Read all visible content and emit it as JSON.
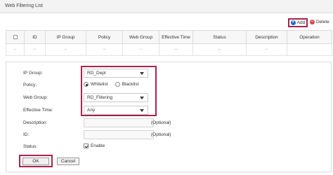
{
  "title": "Web Filtering List",
  "toolbar": {
    "add_label": "Add",
    "add_icon": "plus-circle-icon",
    "delete_label": "Delete",
    "delete_icon": "minus-circle-icon",
    "accent": "#a8234f"
  },
  "table": {
    "columns": [
      "ID",
      "IP Group",
      "Policy",
      "Web Group",
      "Effective Time",
      "Status",
      "Description",
      "Operation"
    ],
    "empty_row": [
      "--",
      "--",
      "--",
      "--",
      "--",
      "--",
      "--",
      "--"
    ]
  },
  "form": {
    "ip_group": {
      "label": "IP Group:",
      "value": "RD_Dept"
    },
    "policy": {
      "label": "Policy:",
      "options": [
        "Whitelist",
        "Blacklist"
      ],
      "selected": "Whitelist"
    },
    "web_group": {
      "label": "Web Group:",
      "value": "RD_Filtering"
    },
    "effective_time": {
      "label": "Effective Time:",
      "value": "Any"
    },
    "description": {
      "label": "Description:",
      "value": "",
      "hint": "(Optional)"
    },
    "id": {
      "label": "ID:",
      "value": "",
      "hint": "(Optional)"
    },
    "status": {
      "label": "Status:",
      "checkbox_label": "Enable",
      "checked": true
    },
    "ok_label": "OK",
    "cancel_label": "Cancel"
  }
}
